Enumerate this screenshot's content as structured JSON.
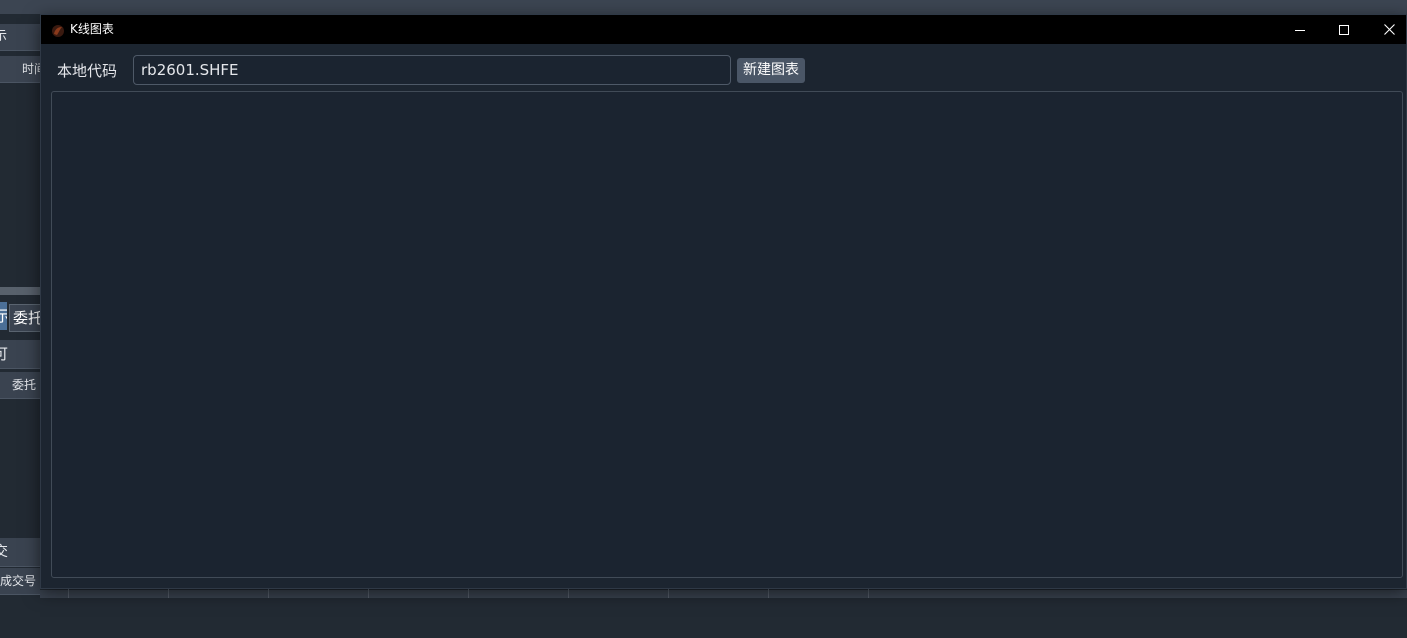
{
  "background_window": {
    "row1_text": "示",
    "row2_text": "时间",
    "tab_active_text": "示",
    "tab_2_text": "委托",
    "row3_text": "可",
    "row4_text": "委托",
    "row5_text": "交",
    "row6_text": "成交号"
  },
  "window": {
    "title": "K线图表",
    "icons": {
      "app": "app-logo-icon",
      "minimize": "minimize-icon",
      "maximize": "maximize-icon",
      "close": "close-icon"
    }
  },
  "toolbar": {
    "code_label": "本地代码",
    "code_value": "rb2601.SHFE",
    "new_chart_label": "新建图表"
  },
  "colors": {
    "dialog_bg": "#1c2530",
    "titlebar_bg": "#000000",
    "button_bg": "#4a5666",
    "border": "#414b57"
  }
}
